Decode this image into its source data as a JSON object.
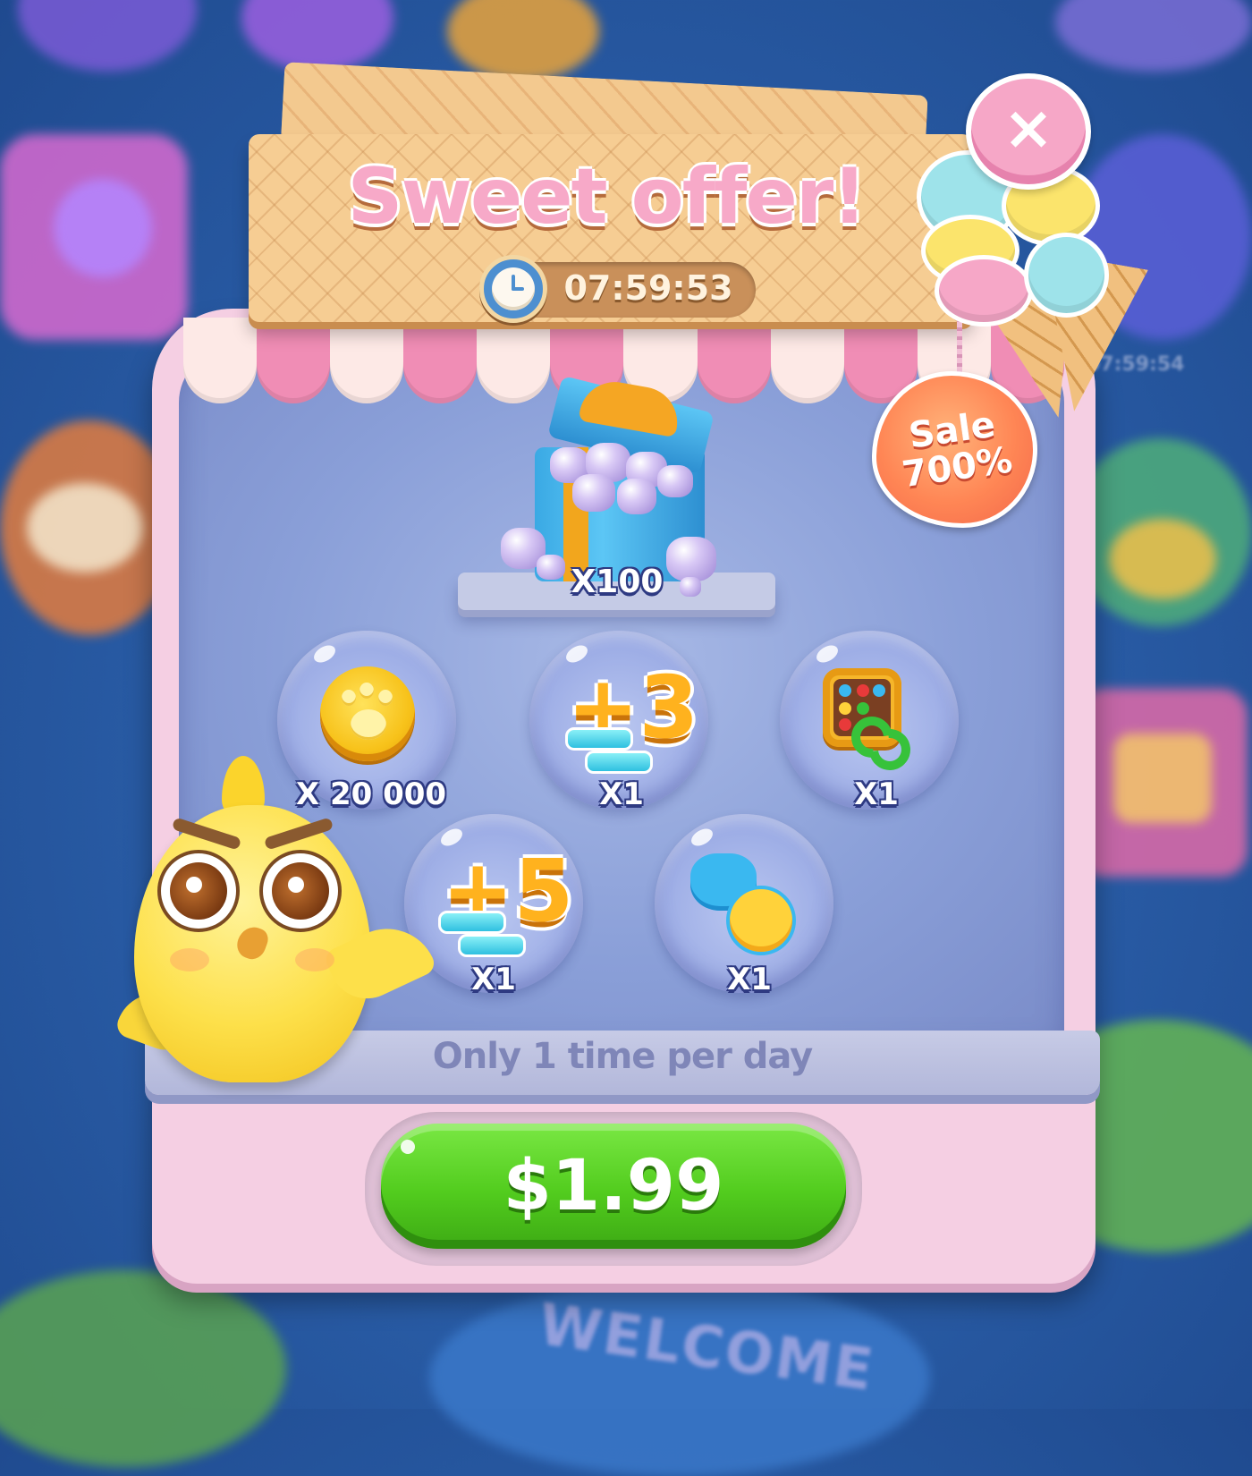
{
  "header": {
    "title": "Sweet offer!",
    "timer": "07:59:53"
  },
  "close_button": {
    "label": "×",
    "icon": "close-icon"
  },
  "sale_tag": {
    "line1": "Sale",
    "line2": "700%"
  },
  "featured_item": {
    "name": "gems-gift-box",
    "count": "X100"
  },
  "items": [
    {
      "name": "paw-coins",
      "count": "X 20 000"
    },
    {
      "name": "plus-3-moves",
      "count": "X1"
    },
    {
      "name": "shuffle-board-booster",
      "count": "X1"
    },
    {
      "name": "plus-5-moves",
      "count": "X1"
    },
    {
      "name": "pets-booster",
      "count": "X1"
    }
  ],
  "booster_labels": {
    "plus3": "+3",
    "plus5": "+5"
  },
  "limit_text": "Only 1 time per day",
  "buy_button": {
    "price": "$1.99"
  },
  "background": {
    "welcome_sign": "WELCOME",
    "side_timer": "07:59:54"
  },
  "colors": {
    "title_pink": "#f7a9c8",
    "panel_pink": "#f5cfe3",
    "buy_green": "#52cc1e",
    "sale_orange": "#ff8655"
  }
}
